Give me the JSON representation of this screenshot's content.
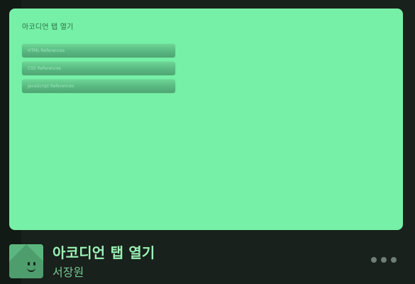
{
  "preview": {
    "title": "아코디언 탭 열기",
    "accordion_items": [
      {
        "label": "HTML References"
      },
      {
        "label": "CSS References"
      },
      {
        "label": "JavaScript References"
      }
    ]
  },
  "pen": {
    "title": "아코디언 탭 열기",
    "author": "서장원",
    "more_icon": "ellipsis-icon"
  },
  "colors": {
    "background": "#141c17",
    "preview_bg": "#76f0a6",
    "accent": "#9cf1b6",
    "accordion": "#58b780"
  }
}
